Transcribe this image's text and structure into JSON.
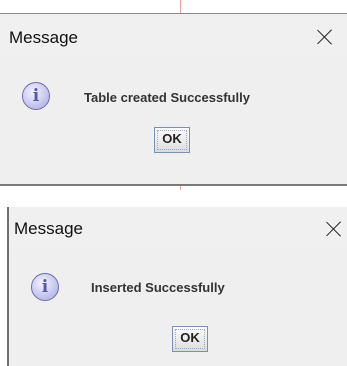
{
  "dialogs": [
    {
      "title": "Message",
      "icon": "info-icon",
      "icon_glyph": "i",
      "message": "Table created Successfully",
      "ok_label": "OK"
    },
    {
      "title": "Message",
      "icon": "info-icon",
      "icon_glyph": "i",
      "message": "Inserted Successfully",
      "ok_label": "OK"
    }
  ],
  "colors": {
    "dialog_background": "#efefef",
    "icon_fill": "#c9c8ef",
    "icon_border": "#6e6cb6",
    "button_border": "#7b8fb0"
  }
}
